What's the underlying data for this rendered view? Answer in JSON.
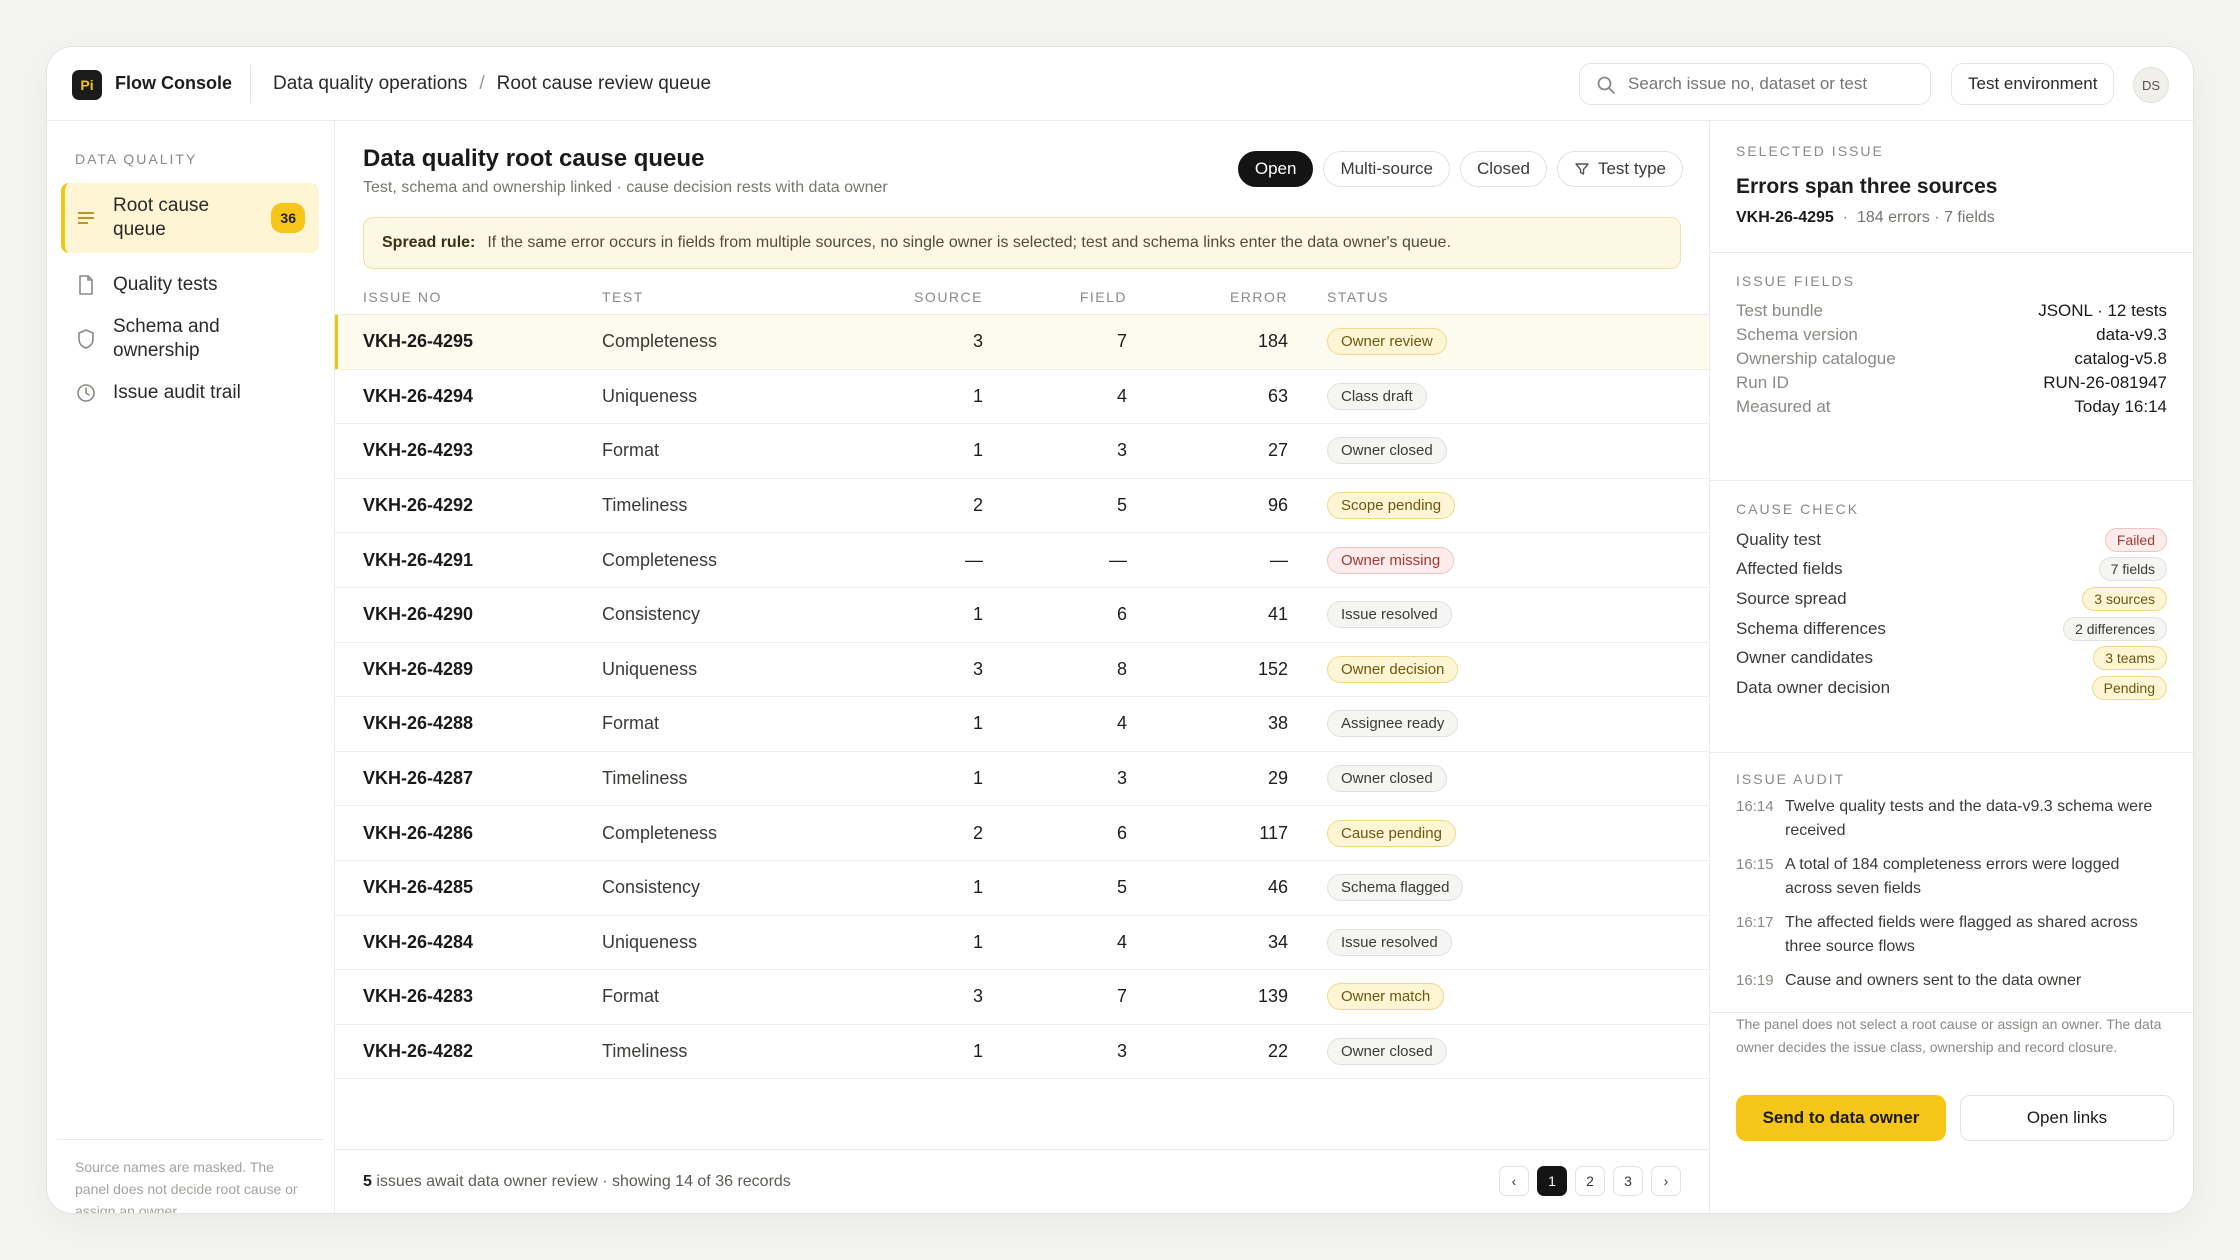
{
  "app": {
    "logo": "Pi",
    "name": "Flow Console"
  },
  "breadcrumb": [
    "Data quality operations",
    "Root cause review queue"
  ],
  "search": {
    "placeholder": "Search issue no, dataset or test"
  },
  "environment_label": "Test environment",
  "user_initials": "DS",
  "sidebar": {
    "section_title": "DATA QUALITY",
    "items": [
      {
        "label": "Root cause queue",
        "badge": "36",
        "icon": "list-icon"
      },
      {
        "label": "Quality tests",
        "icon": "document-icon"
      },
      {
        "label": "Schema and ownership",
        "icon": "shield-icon"
      },
      {
        "label": "Issue audit trail",
        "icon": "clock-icon"
      }
    ],
    "footnote": "Source names are masked. The panel does not decide root cause or assign an owner."
  },
  "main": {
    "title": "Data quality root cause queue",
    "subtitle": "Test, schema and ownership linked · cause decision rests with data owner",
    "filters": [
      "Open",
      "Multi-source",
      "Closed",
      "Test type"
    ],
    "spread_rule_label": "Spread rule:",
    "spread_rule_text": "If the same error occurs in fields from multiple sources, no single owner is selected; test and schema links enter the data owner's queue.",
    "columns": [
      "ISSUE NO",
      "TEST",
      "SOURCE",
      "FIELD",
      "ERROR",
      "STATUS"
    ],
    "rows": [
      {
        "no": "VKH-26-4295",
        "test": "Completeness",
        "source": "3",
        "field": "7",
        "error": "184",
        "status": "Owner review",
        "tone": "y"
      },
      {
        "no": "VKH-26-4294",
        "test": "Uniqueness",
        "source": "1",
        "field": "4",
        "error": "63",
        "status": "Class draft",
        "tone": "g"
      },
      {
        "no": "VKH-26-4293",
        "test": "Format",
        "source": "1",
        "field": "3",
        "error": "27",
        "status": "Owner closed",
        "tone": "g"
      },
      {
        "no": "VKH-26-4292",
        "test": "Timeliness",
        "source": "2",
        "field": "5",
        "error": "96",
        "status": "Scope pending",
        "tone": "y"
      },
      {
        "no": "VKH-26-4291",
        "test": "Completeness",
        "source": "—",
        "field": "—",
        "error": "—",
        "status": "Owner missing",
        "tone": "r"
      },
      {
        "no": "VKH-26-4290",
        "test": "Consistency",
        "source": "1",
        "field": "6",
        "error": "41",
        "status": "Issue resolved",
        "tone": "g"
      },
      {
        "no": "VKH-26-4289",
        "test": "Uniqueness",
        "source": "3",
        "field": "8",
        "error": "152",
        "status": "Owner decision",
        "tone": "y"
      },
      {
        "no": "VKH-26-4288",
        "test": "Format",
        "source": "1",
        "field": "4",
        "error": "38",
        "status": "Assignee ready",
        "tone": "g"
      },
      {
        "no": "VKH-26-4287",
        "test": "Timeliness",
        "source": "1",
        "field": "3",
        "error": "29",
        "status": "Owner closed",
        "tone": "g"
      },
      {
        "no": "VKH-26-4286",
        "test": "Completeness",
        "source": "2",
        "field": "6",
        "error": "117",
        "status": "Cause pending",
        "tone": "y"
      },
      {
        "no": "VKH-26-4285",
        "test": "Consistency",
        "source": "1",
        "field": "5",
        "error": "46",
        "status": "Schema flagged",
        "tone": "g"
      },
      {
        "no": "VKH-26-4284",
        "test": "Uniqueness",
        "source": "1",
        "field": "4",
        "error": "34",
        "status": "Issue resolved",
        "tone": "g"
      },
      {
        "no": "VKH-26-4283",
        "test": "Format",
        "source": "3",
        "field": "7",
        "error": "139",
        "status": "Owner match",
        "tone": "y"
      },
      {
        "no": "VKH-26-4282",
        "test": "Timeliness",
        "source": "1",
        "field": "3",
        "error": "22",
        "status": "Owner closed",
        "tone": "g"
      }
    ],
    "footer_count": "5",
    "footer_text": "issues await data owner review · showing 14 of 36 records",
    "pages": [
      "‹",
      "1",
      "2",
      "3",
      "›"
    ]
  },
  "panel": {
    "selected_label": "SELECTED ISSUE",
    "title": "Errors span three sources",
    "issue_no": "VKH-26-4295",
    "issue_meta": "184 errors · 7 fields",
    "fields_label": "ISSUE FIELDS",
    "fields": [
      {
        "k": "Test bundle",
        "v": "JSONL · 12 tests"
      },
      {
        "k": "Schema version",
        "v": "data-v9.3"
      },
      {
        "k": "Ownership catalogue",
        "v": "catalog-v5.8"
      },
      {
        "k": "Run ID",
        "v": "RUN-26-081947"
      },
      {
        "k": "Measured at",
        "v": "Today 16:14"
      }
    ],
    "cause_label": "CAUSE CHECK",
    "checks": [
      {
        "k": "Quality test",
        "v": "Failed",
        "tone": "r"
      },
      {
        "k": "Affected fields",
        "v": "7 fields",
        "tone": "g"
      },
      {
        "k": "Source spread",
        "v": "3 sources",
        "tone": "y"
      },
      {
        "k": "Schema differences",
        "v": "2 differences",
        "tone": "g"
      },
      {
        "k": "Owner candidates",
        "v": "3 teams",
        "tone": "y"
      },
      {
        "k": "Data owner decision",
        "v": "Pending",
        "tone": "y"
      }
    ],
    "audit_label": "ISSUE AUDIT",
    "audit": [
      {
        "t": "16:14",
        "d": "Twelve quality tests and the data-v9.3 schema were received"
      },
      {
        "t": "16:15",
        "d": "A total of 184 completeness errors were logged across seven fields"
      },
      {
        "t": "16:17",
        "d": "The affected fields were flagged as shared across three source flows"
      },
      {
        "t": "16:19",
        "d": "Cause and owners sent to the data owner"
      }
    ],
    "note": "The panel does not select a root cause or assign an owner. The data owner decides the issue class, ownership and record closure.",
    "primary_button": "Send to data owner",
    "secondary_button": "Open links"
  }
}
